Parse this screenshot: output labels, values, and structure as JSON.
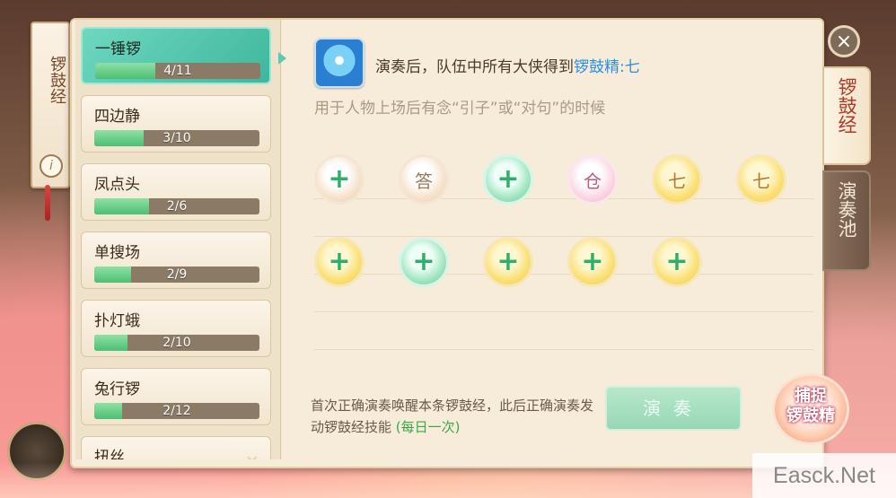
{
  "scroll_tab": {
    "title": "锣鼓经",
    "info": "i"
  },
  "list": [
    {
      "name": "一锤锣",
      "progress": "4/11",
      "fraction": 0.364,
      "active": true
    },
    {
      "name": "四边静",
      "progress": "3/10",
      "fraction": 0.3,
      "active": false
    },
    {
      "name": "凤点头",
      "progress": "2/6",
      "fraction": 0.333,
      "active": false
    },
    {
      "name": "单搜场",
      "progress": "2/9",
      "fraction": 0.222,
      "active": false
    },
    {
      "name": "扑灯蛾",
      "progress": "2/10",
      "fraction": 0.2,
      "active": false
    },
    {
      "name": "兔行锣",
      "progress": "2/12",
      "fraction": 0.167,
      "active": false
    },
    {
      "name": "扭丝",
      "progress": "",
      "fraction": 0,
      "active": false
    }
  ],
  "detail": {
    "effect_prefix": "演奏后，队伍中所有大侠得到",
    "effect_highlight": "锣鼓精:七",
    "description": "用于人物上场后有念“引子”或“对句”的时候",
    "footer_main": "首次正确演奏唤醒本条锣鼓经，此后正确演奏发动锣鼓经技能",
    "footer_daily": "(每日一次)",
    "play_button": "演奏"
  },
  "slots_row1": [
    {
      "type": "peach",
      "symbol": "+"
    },
    {
      "type": "peach",
      "symbol": "答"
    },
    {
      "type": "green",
      "symbol": "+"
    },
    {
      "type": "pink",
      "symbol": "仓"
    },
    {
      "type": "gold",
      "symbol": "七"
    },
    {
      "type": "gold",
      "symbol": "七"
    }
  ],
  "slots_row2": [
    {
      "type": "gold",
      "symbol": "+"
    },
    {
      "type": "green",
      "symbol": "+"
    },
    {
      "type": "gold",
      "symbol": "+"
    },
    {
      "type": "gold",
      "symbol": "+"
    },
    {
      "type": "gold",
      "symbol": "+"
    }
  ],
  "side_tabs": [
    {
      "label": "锣鼓经",
      "active": true
    },
    {
      "label": "演奏池",
      "active": false
    }
  ],
  "catch_badge": {
    "line1": "捕捉",
    "line2": "锣鼓精"
  },
  "close": "×",
  "watermark": "Easck.Net",
  "colors": {
    "accent_teal": "#4cc3a6",
    "highlight_blue": "#2b8fe0",
    "daily_green": "#3aa84a"
  }
}
